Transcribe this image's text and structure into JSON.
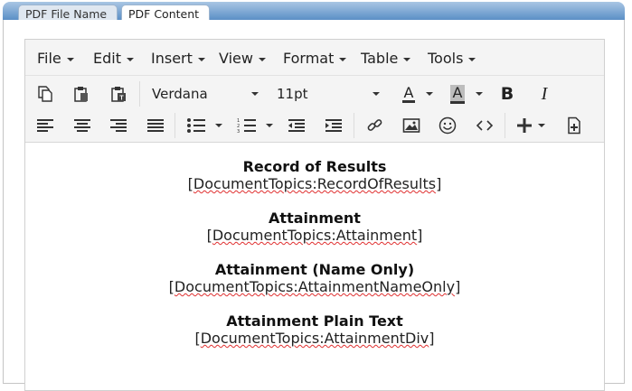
{
  "tabs": [
    {
      "label": "PDF File Name",
      "active": false
    },
    {
      "label": "PDF Content",
      "active": true
    }
  ],
  "menu": [
    "File",
    "Edit",
    "Insert",
    "View",
    "Format",
    "Table",
    "Tools"
  ],
  "toolbar": {
    "font_family": "Verdana",
    "font_size": "11pt",
    "text_color_label": "A",
    "highlight_label": "A",
    "bold_label": "B",
    "italic_label": "I"
  },
  "content": [
    {
      "heading": "Record of Results",
      "field": "DocumentTopics:RecordOfResults"
    },
    {
      "heading": "Attainment",
      "field": "DocumentTopics:Attainment"
    },
    {
      "heading": "Attainment (Name Only)",
      "field": "DocumentTopics:AttainmentNameOnly"
    },
    {
      "heading": "Attainment Plain Text",
      "field": "DocumentTopics:AttainmentDiv"
    }
  ],
  "colors": {
    "tab_gradient_top": "#a9c6e4",
    "tab_gradient_bottom": "#5b8fc6",
    "toolbar_bg": "#f4f4f4",
    "spellcheck": "#e03030"
  }
}
